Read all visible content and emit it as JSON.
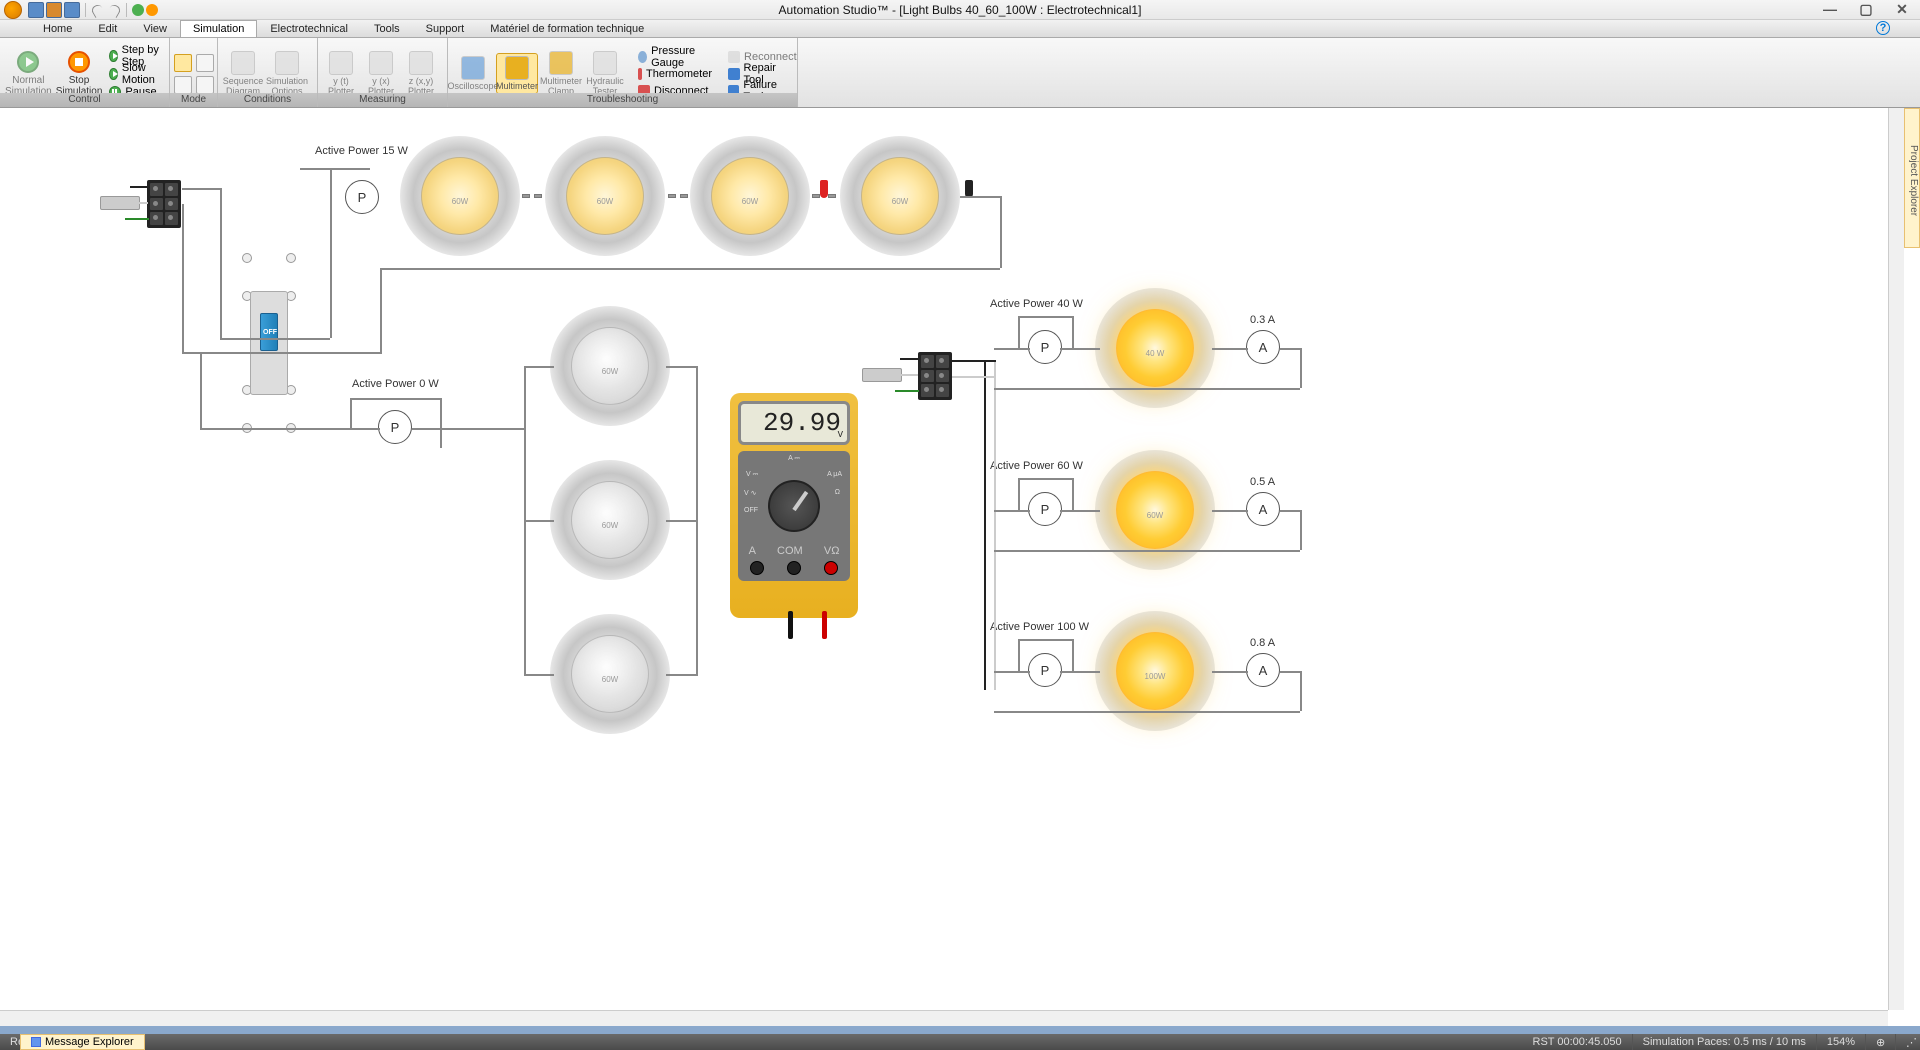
{
  "window": {
    "title": "Automation Studio™ - [Light Bulbs 40_60_100W : Electrotechnical1]",
    "min": "—",
    "max": "▢",
    "close": "✕"
  },
  "menu": {
    "tabs": [
      "Home",
      "Edit",
      "View",
      "Simulation",
      "Electrotechnical",
      "Tools",
      "Support",
      "Matériel de formation technique"
    ],
    "active_index": 3
  },
  "ribbon": {
    "control": {
      "label": "Control",
      "normal": "Normal\nSimulation",
      "stop": "Stop\nSimulation",
      "step": "Step by Step",
      "slow": "Slow Motion",
      "pause": "Pause"
    },
    "mode": {
      "label": "Mode"
    },
    "conditions": {
      "label": "Conditions",
      "seq": "Sequence\nDiagram",
      "opts": "Simulation\nOptions"
    },
    "measuring": {
      "label": "Measuring",
      "yt": "y (t)\nPlotter",
      "yx": "y (x)\nPlotter",
      "zxy": "z (x,y)\nPlotter"
    },
    "troubleshooting": {
      "label": "Troubleshooting",
      "osc": "Oscilloscope",
      "mm": "Multimeter",
      "mmc": "Multimeter\nClamp",
      "hyd": "Hydraulic\nTester",
      "pressure": "Pressure Gauge",
      "thermo": "Thermometer",
      "disc": "Disconnect",
      "reconn": "Reconnect",
      "repair": "Repair Tool",
      "failure": "Failure Tool"
    }
  },
  "side_tab": "Project Explorer",
  "circuit": {
    "top_power_label": "Active Power 15 W",
    "mid_power_label": "Active Power 0 W",
    "r1_power": "Active Power 40 W",
    "r1_amp": "0.3 A",
    "r2_power": "Active Power 60 W",
    "r2_amp": "0.5 A",
    "r3_power": "Active Power 100 W",
    "r3_amp": "0.8 A",
    "bulb60": "60W",
    "bulb40": "40 W",
    "bulb100": "100W",
    "switch_state": "OFF"
  },
  "multimeter": {
    "reading": "29.99"
  },
  "status": {
    "ready": "Ready",
    "msg_explorer": "Message Explorer",
    "rst": "RST 00:00:45.050",
    "paces": "Simulation Paces: 0.5 ms / 10 ms",
    "zoom": "154%"
  }
}
